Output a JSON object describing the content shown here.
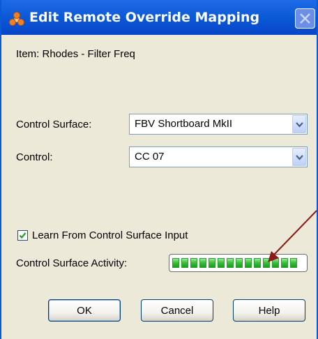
{
  "window": {
    "title": "Edit Remote Override Mapping"
  },
  "item_label": "Item: Rhodes - Filter Freq",
  "control_surface": {
    "label": "Control Surface:",
    "value": "FBV Shortboard MkII"
  },
  "control": {
    "label": "Control:",
    "value": "CC 07"
  },
  "learn": {
    "label": "Learn From Control Surface Input",
    "checked": true
  },
  "activity": {
    "label": "Control Surface Activity:",
    "level": 1.0,
    "color": "#3ec13e"
  },
  "buttons": {
    "ok": "OK",
    "cancel": "Cancel",
    "help": "Help"
  },
  "colors": {
    "titlebar": "#0a57d5",
    "dialog_bg": "#ece9d8",
    "annotation_arrow": "#8b1a1a"
  }
}
